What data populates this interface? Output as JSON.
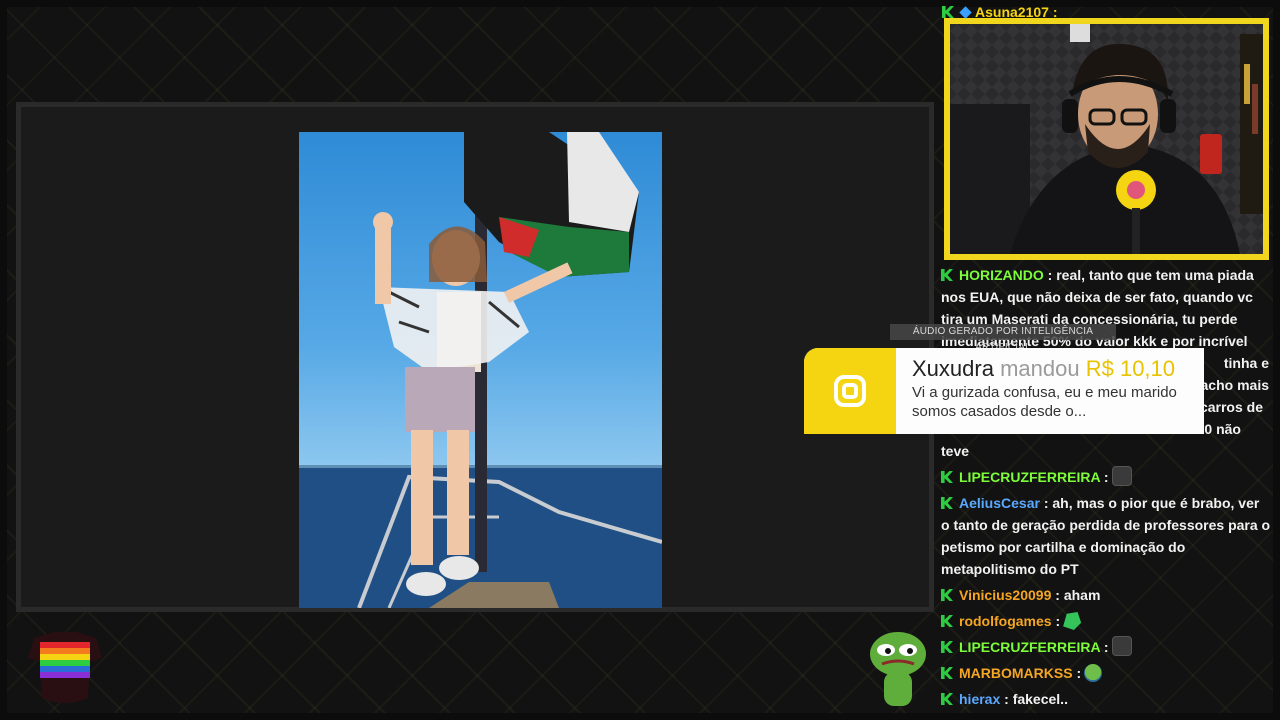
{
  "media": {
    "description_name": "shared-photo"
  },
  "alert": {
    "label": "ÁUDIO GERADO POR INTELIGÊNCIA ARTIFICIAL",
    "donor": "Xuxudra",
    "verb": "mandou",
    "amount": "R$ 10,10",
    "message": "Vi a gurizada confusa, eu e meu marido somos casados desde o...",
    "accent": "#f5d511"
  },
  "chat": {
    "top_user": "Asuna2107 :",
    "messages": [
      {
        "user": "HORIZANDO",
        "color": "#7cfc3a",
        "text": " : real, tanto que tem uma piada nos EUA, que não deixa de ser fato, quando vc tira um Maserati da concessionária, tu perde imediatamente 50% do valor kkk e por incrível",
        "emote": ""
      },
      {
        "user": "",
        "color": "",
        "text": "tinha e",
        "emote": ""
      },
      {
        "user": "",
        "color": "",
        "text": "acho mais",
        "emote": ""
      },
      {
        "user": "",
        "color": "",
        "text": "carros de",
        "emote": ""
      },
      {
        "user": "",
        "color": "",
        "text": "0220 não",
        "emote": ""
      },
      {
        "user": "",
        "color": "",
        "text": "teve",
        "emote": ""
      },
      {
        "user": "LIPECRUZFERREIRA",
        "color": "#7cfc3a",
        "text": " :",
        "emote": "dark"
      },
      {
        "user": "AeliusCesar",
        "color": "#5aa9ff",
        "text": " : ah, mas o pior que é brabo, ver o tanto de geração perdida de professores para o petismo por cartilha e dominação do metapolitismo do PT",
        "emote": ""
      },
      {
        "user": "Vinicius20099",
        "color": "#f5a623",
        "text": " : aham",
        "emote": ""
      },
      {
        "user": "rodolfogames",
        "color": "#f5a623",
        "text": " :",
        "emote": "green"
      },
      {
        "user": "LIPECRUZFERREIRA",
        "color": "#7cfc3a",
        "text": " :",
        "emote": "dark"
      },
      {
        "user": "MARBOMARKSS",
        "color": "#f5a623",
        "text": " :",
        "emote": "pepe"
      },
      {
        "user": "hierax",
        "color": "#5aa9ff",
        "text": " : fakecel..",
        "emote": ""
      }
    ]
  },
  "colors": {
    "cam_border": "#f0d61d",
    "background": "#121212"
  }
}
